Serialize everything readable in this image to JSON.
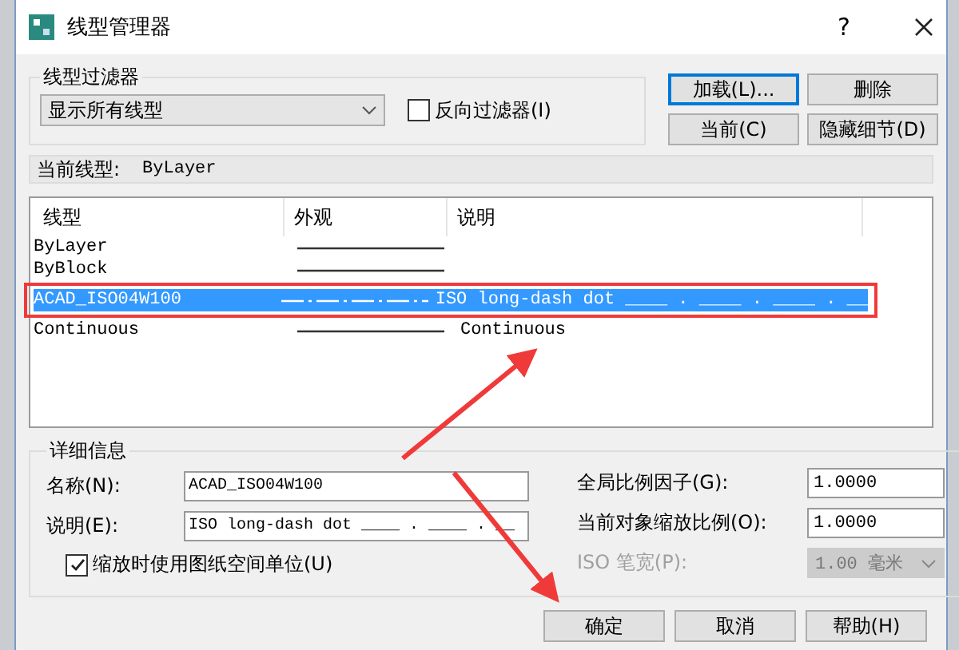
{
  "window": {
    "title": "线型管理器",
    "help": "?"
  },
  "filter": {
    "label": "线型过滤器",
    "value": "显示所有线型",
    "invert": {
      "label": "反向过滤器(I)",
      "checked": false
    }
  },
  "top_buttons": [
    {
      "label": "加载(L)...",
      "focused": true
    },
    {
      "label": "删除",
      "focused": false
    },
    {
      "label": "当前(C)",
      "focused": false
    },
    {
      "label": "隐藏细节(D)",
      "focused": false
    }
  ],
  "current": {
    "label": "当前线型:",
    "value": "ByLayer"
  },
  "list": {
    "columns": [
      "线型",
      "外观",
      "说明"
    ],
    "rows": [
      {
        "name": "ByLayer",
        "kind": "solid",
        "description": "",
        "selected": false
      },
      {
        "name": "ByBlock",
        "kind": "solid",
        "description": "",
        "selected": false
      },
      {
        "name": "ACAD_ISO04W100",
        "kind": "dash-dot",
        "description": "ISO long-dash dot ____ . ____ . ____ . __",
        "selected": true
      },
      {
        "name": "Continuous",
        "kind": "solid",
        "description": "Continuous",
        "selected": false
      }
    ]
  },
  "details": {
    "title": "详细信息",
    "left_fields": [
      {
        "label": "名称(N):",
        "value": "ACAD_ISO04W100"
      },
      {
        "label": "说明(E):",
        "value": "ISO long-dash dot ____ . ____ . __"
      }
    ],
    "paper_units": {
      "label": "缩放时使用图纸空间单位(U)",
      "checked": true
    },
    "right_fields": [
      {
        "label": "全局比例因子(G):",
        "value": "1.0000",
        "kind": "text",
        "disabled": false
      },
      {
        "label": "当前对象缩放比例(O):",
        "value": "1.0000",
        "kind": "text",
        "disabled": false
      },
      {
        "label": "ISO 笔宽(P):",
        "value": "1.00 毫米",
        "kind": "dropdown",
        "disabled": true
      }
    ]
  },
  "footer_buttons": [
    {
      "label": "确定"
    },
    {
      "label": "取消"
    },
    {
      "label": "帮助(H)"
    }
  ]
}
